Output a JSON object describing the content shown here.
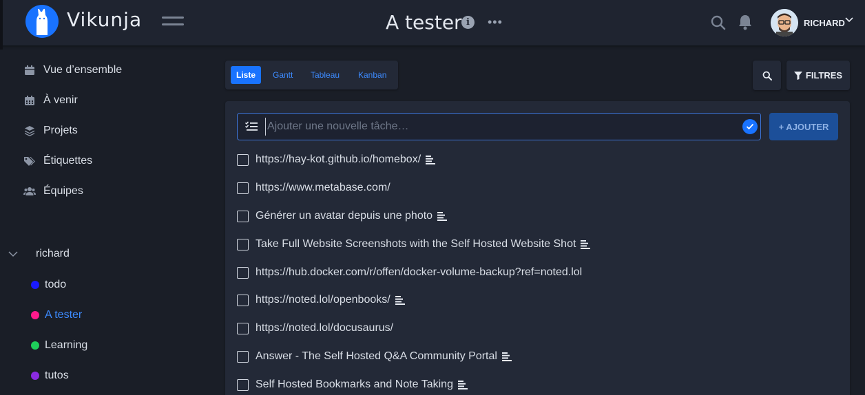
{
  "app": {
    "name": "Vikunja"
  },
  "header": {
    "title": "A tester",
    "user_name": "RICHARD",
    "icons": [
      "menu-icon",
      "info-icon",
      "more-icon",
      "search-icon",
      "bell-icon",
      "avatar",
      "chevron-down-icon"
    ]
  },
  "sidebar": {
    "nav": [
      {
        "label": "Vue d’ensemble",
        "icon": "calendar-icon"
      },
      {
        "label": "À venir",
        "icon": "calendar-grid-icon"
      },
      {
        "label": "Projets",
        "icon": "layers-icon"
      },
      {
        "label": "Étiquettes",
        "icon": "tags-icon"
      },
      {
        "label": "Équipes",
        "icon": "users-icon"
      }
    ],
    "parent_project": "richard",
    "projects": [
      {
        "label": "todo",
        "color": "#1a1aff"
      },
      {
        "label": "A tester",
        "color": "#ff1a8c",
        "active": true
      },
      {
        "label": "Learning",
        "color": "#1ecf5a"
      },
      {
        "label": "tutos",
        "color": "#8a2be2"
      }
    ]
  },
  "views": {
    "tabs": [
      "Liste",
      "Gantt",
      "Tableau",
      "Kanban"
    ],
    "active": "Liste"
  },
  "toolbar": {
    "filter_label": "FILTRES"
  },
  "new_task": {
    "placeholder": "Ajouter une nouvelle tâche…",
    "add_label": "+ AJOUTER"
  },
  "tasks": [
    {
      "title": "https://hay-kot.github.io/homebox/",
      "has_description": true
    },
    {
      "title": "https://www.metabase.com/",
      "has_description": false
    },
    {
      "title": "Générer un avatar depuis une photo",
      "has_description": true
    },
    {
      "title": "Take Full Website Screenshots with the Self Hosted Website Shot",
      "has_description": true
    },
    {
      "title": "https://hub.docker.com/r/offen/docker-volume-backup?ref=noted.lol",
      "has_description": false
    },
    {
      "title": "https://noted.lol/openbooks/",
      "has_description": true
    },
    {
      "title": "https://noted.lol/docusaurus/",
      "has_description": false
    },
    {
      "title": "Answer - The Self Hosted Q&A Community Portal",
      "has_description": true
    },
    {
      "title": "Self Hosted Bookmarks and Note Taking",
      "has_description": true
    }
  ],
  "colors": {
    "accent": "#1973ff",
    "background": "#1a1e27",
    "surface": "#232937"
  }
}
